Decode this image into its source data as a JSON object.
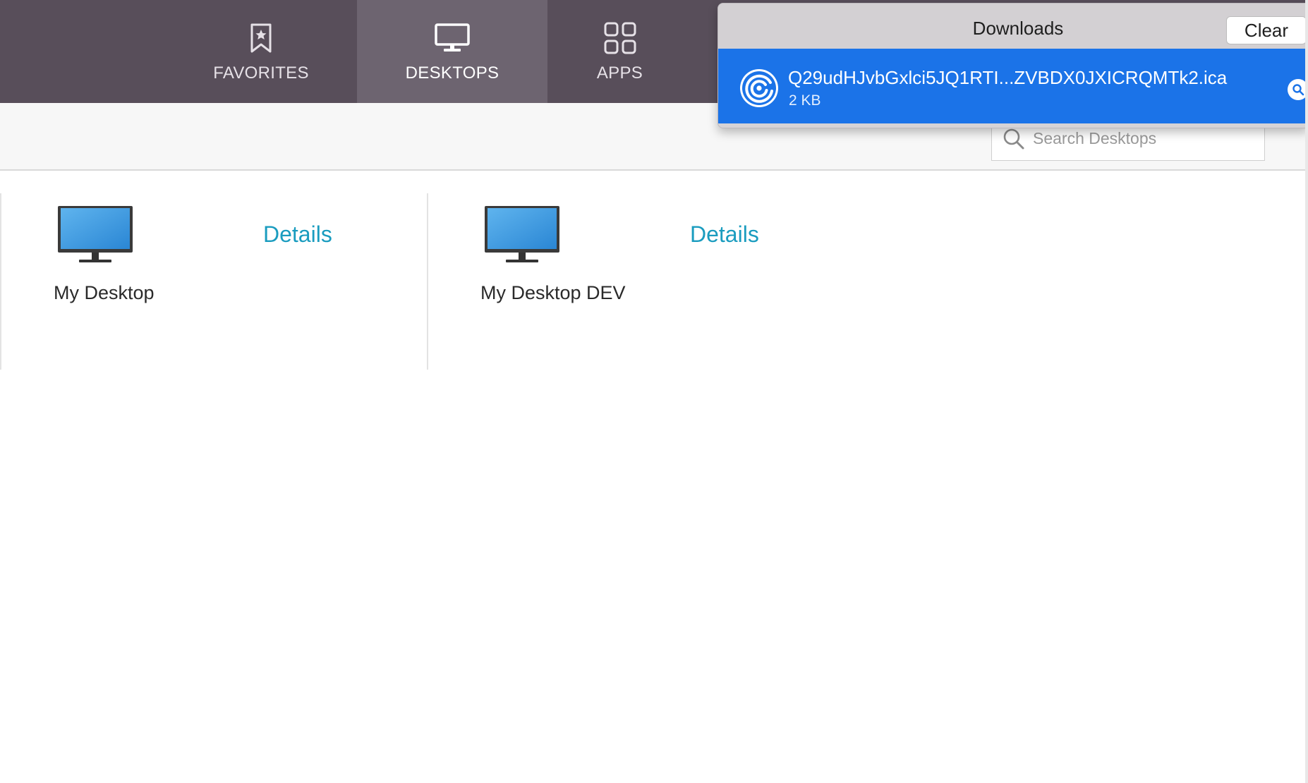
{
  "nav": {
    "tabs": [
      {
        "label": "FAVORITES",
        "icon": "bookmark-star-icon",
        "active": false
      },
      {
        "label": "DESKTOPS",
        "icon": "monitor-icon",
        "active": true
      },
      {
        "label": "APPS",
        "icon": "grid-icon",
        "active": false
      }
    ]
  },
  "search": {
    "placeholder": "Search Desktops",
    "value": ""
  },
  "desktops": [
    {
      "name": "My Desktop",
      "details_label": "Details",
      "icon": "desktop-monitor-icon"
    },
    {
      "name": "My Desktop DEV",
      "details_label": "Details",
      "icon": "desktop-monitor-icon"
    }
  ],
  "downloads": {
    "title": "Downloads",
    "clear_label": "Clear",
    "items": [
      {
        "filename": "Q29udHJvbGxlci5JQ1RTI...ZVBDX0JXICRQMTk2.ica",
        "size": "2 KB",
        "icon": "citrix-receiver-icon"
      }
    ]
  },
  "colors": {
    "nav_bg": "#584e5a",
    "nav_active_bg": "#6d6470",
    "link": "#1a9cbf",
    "download_highlight": "#1b73e8"
  }
}
